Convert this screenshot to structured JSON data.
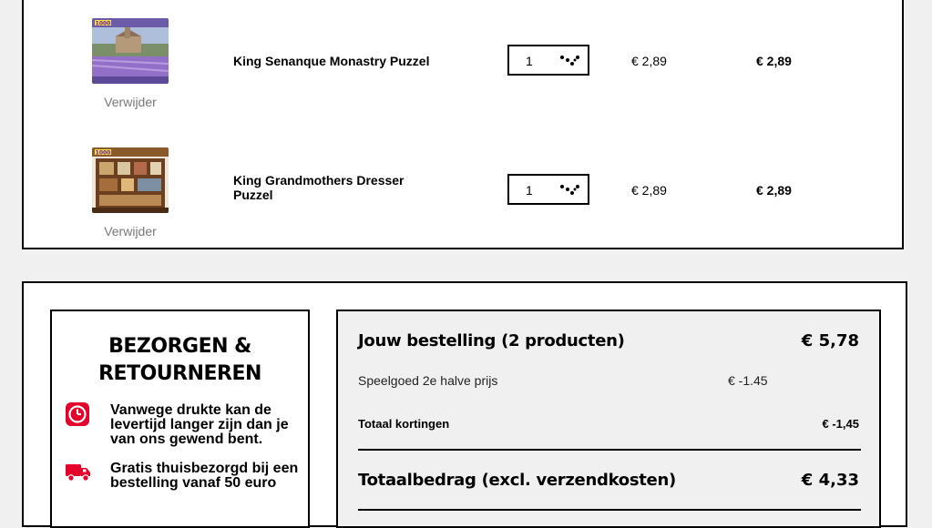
{
  "cart": {
    "items": [
      {
        "name": "King Senanque Monastry Puzzel",
        "remove_label": "Verwijder",
        "quantity": "1",
        "quantity_icon": "dots-icon",
        "unit_price": "€ 2,89",
        "line_total": "€ 2,89",
        "thumbnail_icon": "puzzle-box-lavender-monastery",
        "thumbnail_badge": "1000"
      },
      {
        "name": "King Grandmothers Dresser Puzzel",
        "remove_label": "Verwijder",
        "quantity": "1",
        "quantity_icon": "dots-icon",
        "unit_price": "€ 2,89",
        "line_total": "€ 2,89",
        "thumbnail_icon": "puzzle-box-dresser",
        "thumbnail_badge": "1000"
      }
    ]
  },
  "delivery": {
    "title": "BEZORGEN & RETOURNEREN",
    "rows": [
      {
        "icon": "clock-icon",
        "text": "Vanwege drukte kan de levertijd langer zijn dan je van ons gewend bent."
      },
      {
        "icon": "truck-icon",
        "text": "Gratis thuisbezorgd bij een bestelling vanaf 50 euro"
      }
    ]
  },
  "summary": {
    "order_label": "Jouw bestelling (2 producten)",
    "order_amount": "€ 5,78",
    "discount_label": "Speelgoed 2e halve prijs",
    "discount_value": "€ -1.45",
    "total_discounts_label": "Totaal kortingen",
    "total_discounts_value": "€ -1,45",
    "grand_total_label": "Totaalbedrag (excl. verzendkosten)",
    "grand_total_value": "€ 4,33"
  },
  "colors": {
    "background": "#f0f0f0",
    "border": "#000000",
    "icon_red": "#e4002b",
    "muted_text": "#777777"
  }
}
